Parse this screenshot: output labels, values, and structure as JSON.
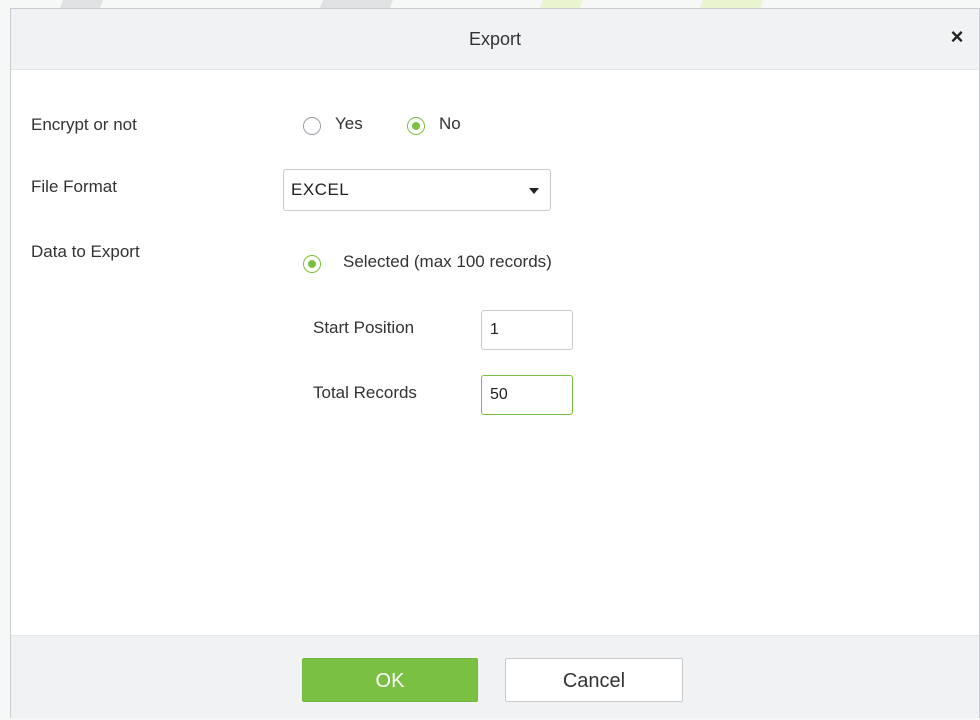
{
  "dialog": {
    "title": "Export",
    "close_glyph": "×"
  },
  "encrypt": {
    "label": "Encrypt or not",
    "options": [
      {
        "label": "Yes",
        "checked": false
      },
      {
        "label": "No",
        "checked": true
      }
    ]
  },
  "file_format": {
    "label": "File Format",
    "value": "EXCEL"
  },
  "data_to_export": {
    "label": "Data to Export",
    "option_label": "Selected (max 100 records)",
    "option_checked": true,
    "start_position": {
      "label": "Start Position",
      "value": "1"
    },
    "total_records": {
      "label": "Total Records",
      "value": "50"
    }
  },
  "footer": {
    "ok_label": "OK",
    "cancel_label": "Cancel"
  },
  "colors": {
    "accent": "#7ac143",
    "header_bg": "#f1f2f3"
  }
}
